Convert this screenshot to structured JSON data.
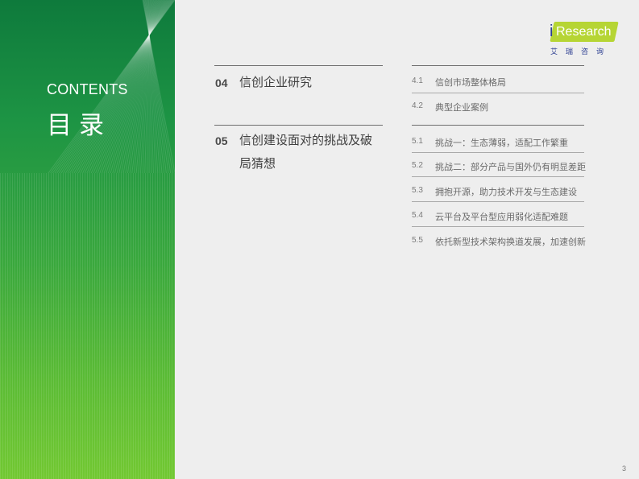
{
  "sidebar": {
    "contents_en": "CONTENTS",
    "contents_cn": "目录"
  },
  "logo": {
    "mark": "i",
    "text": "Research",
    "cn": "艾瑞咨询"
  },
  "sections": [
    {
      "num": "04",
      "title": "信创企业研究"
    },
    {
      "num": "05",
      "title": "信创建设面对的挑战及破局猜想"
    }
  ],
  "subsections_04": [
    {
      "num": "4.1",
      "title": "信创市场整体格局"
    },
    {
      "num": "4.2",
      "title": "典型企业案例"
    }
  ],
  "subsections_05": [
    {
      "num": "5.1",
      "title": "挑战一：生态薄弱，适配工作繁重"
    },
    {
      "num": "5.2",
      "title": "挑战二：部分产品与国外仍有明显差距"
    },
    {
      "num": "5.3",
      "title": "拥抱开源，助力技术开发与生态建设"
    },
    {
      "num": "5.4",
      "title": "云平台及平台型应用弱化适配难题"
    },
    {
      "num": "5.5",
      "title": "依托新型技术架构换道发展，加速创新"
    }
  ],
  "footer": {
    "page_number": "3"
  },
  "colors": {
    "sidebar_top": "#0e7a3c",
    "sidebar_bottom": "#72c832",
    "logo_badge": "#b6d534",
    "logo_blue": "#2c3e91"
  }
}
